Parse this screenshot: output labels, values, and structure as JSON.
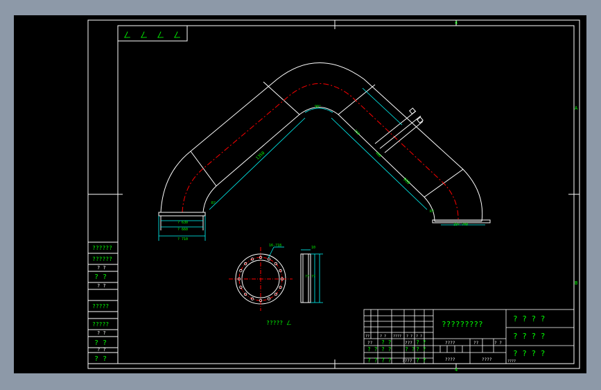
{
  "window": {
    "background_color": "#8d99a8",
    "canvas_color": "#000000"
  },
  "colors": {
    "frame": "#ffffff",
    "geometry": "#ffffff",
    "centerline": "#ff0000",
    "dimension": "#00ffff",
    "text": "#00ff00"
  },
  "drawing": {
    "zone_labels": {
      "top": "4",
      "bottom": "4",
      "right_a": "A",
      "right_b": "B"
    },
    "corner_stamp": [
      "ㄥ",
      "ㄥ",
      "ㄥ",
      "ㄥ"
    ],
    "left_strip": [
      "??????",
      "??????",
      "? ?",
      "? ?",
      "? ?",
      "?????",
      "?????",
      "? ?",
      "? ?",
      "? ?",
      "? ?"
    ],
    "dimensions": {
      "angle_top": "90°",
      "left_leg": "1350",
      "right_leg": "960",
      "right_small": "750",
      "right_lower": "480",
      "left_small": "R?",
      "right_small2": "R?",
      "flange_left_1": "? 630",
      "flange_left_2": "? 660",
      "flange_left_3": "? 710",
      "flange_right": "18× ?40",
      "circle_holes": "16-?18",
      "side_width": "10",
      "side_dims": "?? ??"
    },
    "flange_caption": "????? ㄥ"
  },
  "title_block": {
    "main_title": "?????????",
    "right_column": [
      "? ? ? ?",
      "? ? ? ?",
      "? ? ? ?"
    ],
    "row_a": [
      "??",
      "? ?",
      "????",
      "? ?",
      "? ?"
    ],
    "row_b": [
      "??",
      "? ?",
      "???",
      "? ?"
    ],
    "row_c": [
      "????",
      "??",
      "? ?"
    ],
    "row_d": [
      "? ?",
      "? ?",
      "? ?",
      "? ?"
    ],
    "row_e": [
      "? ?",
      "? ?",
      "????",
      "? ?"
    ],
    "footer_left": "????",
    "footer_mid": "????",
    "footer_right": "????"
  }
}
